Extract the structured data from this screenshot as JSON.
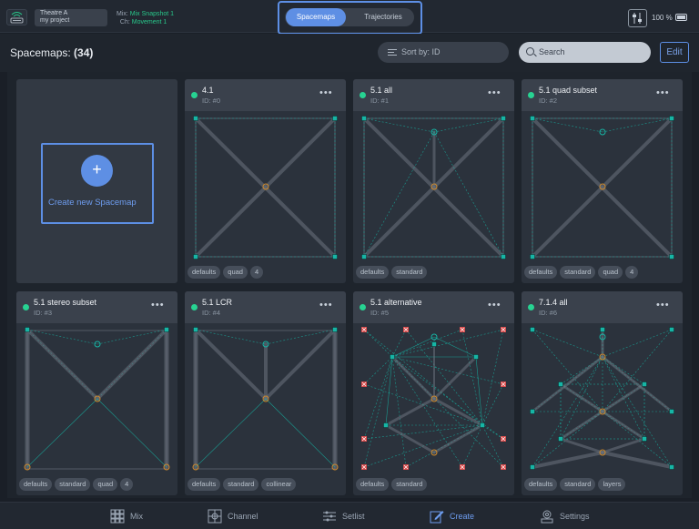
{
  "topbar": {
    "project_line1": "Theatre A",
    "project_line2": "my project",
    "mix_prefix": "Mix:",
    "mix_value": "Mix Snapshot 1",
    "ch_prefix": "Ch:",
    "ch_value": "Movement 1",
    "seg_spacemaps": "Spacemaps",
    "seg_trajectories": "Trajectories",
    "battery": "100 %"
  },
  "header": {
    "title": "Spacemaps:",
    "count": "(34)",
    "sort_label": "Sort by: ID",
    "search_placeholder": "Search",
    "edit_label": "Edit"
  },
  "create": {
    "label": "Create new Spacemap",
    "plus": "+"
  },
  "cards": [
    {
      "name": "4.1",
      "id": "ID: #0",
      "tags": [
        "defaults",
        "quad",
        "4"
      ]
    },
    {
      "name": "5.1 all",
      "id": "ID: #1",
      "tags": [
        "defaults",
        "standard"
      ]
    },
    {
      "name": "5.1 quad subset",
      "id": "ID: #2",
      "tags": [
        "defaults",
        "standard",
        "quad",
        "4"
      ]
    },
    {
      "name": "5.1 stereo subset",
      "id": "ID: #3",
      "tags": [
        "defaults",
        "standard",
        "quad",
        "4"
      ]
    },
    {
      "name": "5.1 LCR",
      "id": "ID: #4",
      "tags": [
        "defaults",
        "standard",
        "collinear"
      ]
    },
    {
      "name": "5.1 alternative",
      "id": "ID: #5",
      "tags": [
        "defaults",
        "standard"
      ]
    },
    {
      "name": "7.1.4 all",
      "id": "ID: #6",
      "tags": [
        "defaults",
        "standard",
        "layers"
      ]
    }
  ],
  "bottombar": {
    "tabs": [
      "Mix",
      "Channel",
      "Setlist",
      "Create",
      "Settings"
    ],
    "active": "Create"
  },
  "colors": {
    "accent": "#5e8fe4",
    "active_dot": "#27d392",
    "speaker": "#16b5a5",
    "virtual_node": "#d08a2b",
    "muted_speaker": "#d84a4a"
  }
}
